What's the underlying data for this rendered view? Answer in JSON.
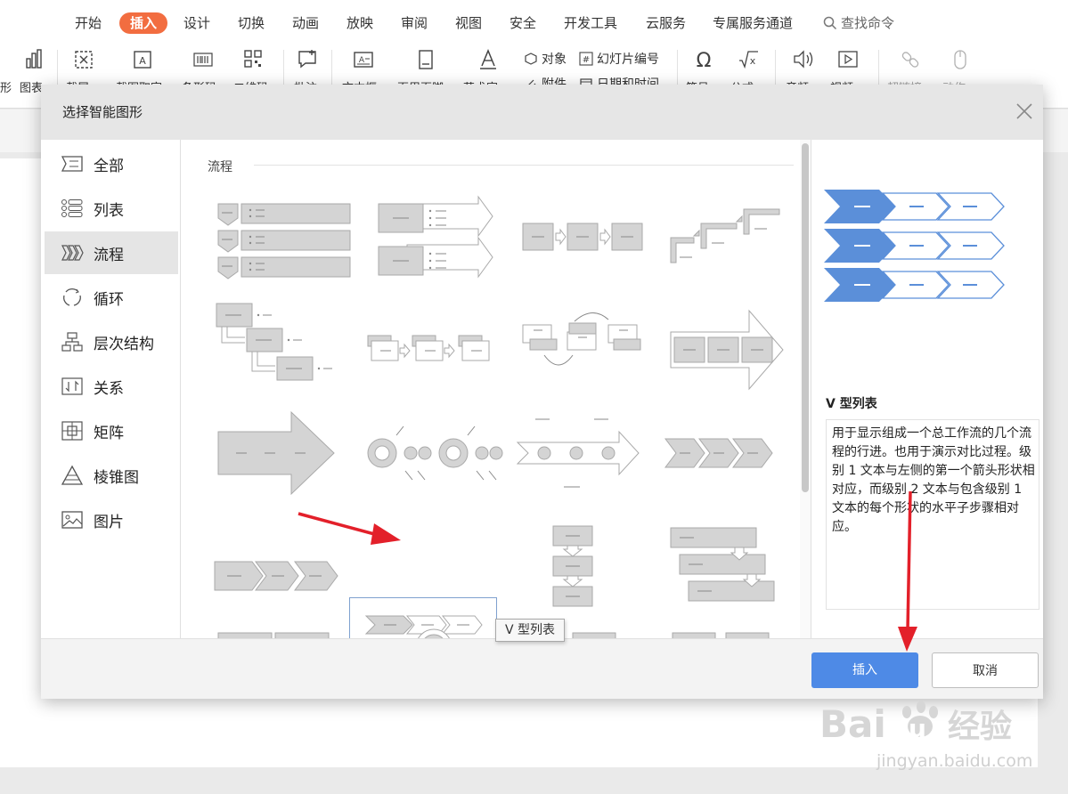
{
  "ribbon": {
    "tabs": [
      {
        "label": "开始",
        "active": false
      },
      {
        "label": "插入",
        "active": true
      },
      {
        "label": "设计",
        "active": false
      },
      {
        "label": "切换",
        "active": false
      },
      {
        "label": "动画",
        "active": false
      },
      {
        "label": "放映",
        "active": false
      },
      {
        "label": "审阅",
        "active": false
      },
      {
        "label": "视图",
        "active": false
      },
      {
        "label": "安全",
        "active": false
      },
      {
        "label": "开发工具",
        "active": false
      },
      {
        "label": "云服务",
        "active": false
      },
      {
        "label": "专属服务通道",
        "active": false
      }
    ],
    "search_label": "查找命令",
    "tools": [
      {
        "label": "形",
        "icon": "shape-icon"
      },
      {
        "label": "图表",
        "icon": "chart-icon"
      },
      {
        "label": "截屏",
        "icon": "screenshot-icon"
      },
      {
        "label": "截图取字",
        "icon": "ocr-icon"
      },
      {
        "label": "条形码",
        "icon": "barcode-icon"
      },
      {
        "label": "二维码",
        "icon": "qrcode-icon"
      },
      {
        "label": "批注",
        "icon": "comment-icon"
      },
      {
        "label": "文本框",
        "icon": "textbox-icon"
      },
      {
        "label": "页眉页脚",
        "icon": "header-footer-icon"
      },
      {
        "label": "艺术字",
        "icon": "wordart-icon"
      },
      {
        "label": "符号",
        "icon": "symbol-icon"
      },
      {
        "label": "公式",
        "icon": "formula-icon"
      },
      {
        "label": "音频",
        "icon": "audio-icon"
      },
      {
        "label": "视频",
        "icon": "video-icon"
      },
      {
        "label": "超链接",
        "icon": "hyperlink-icon"
      },
      {
        "label": "动作",
        "icon": "action-icon"
      }
    ],
    "mini_tools": {
      "object": "对象",
      "slide_number": "幻灯片编号",
      "attachment": "附件",
      "date_time": "日期和时间"
    }
  },
  "dialog": {
    "title": "选择智能图形",
    "categories": [
      {
        "label": "全部",
        "icon": "all-icon",
        "active": false
      },
      {
        "label": "列表",
        "icon": "list-icon",
        "active": false
      },
      {
        "label": "流程",
        "icon": "process-icon",
        "active": true
      },
      {
        "label": "循环",
        "icon": "cycle-icon",
        "active": false
      },
      {
        "label": "层次结构",
        "icon": "hierarchy-icon",
        "active": false
      },
      {
        "label": "关系",
        "icon": "relationship-icon",
        "active": false
      },
      {
        "label": "矩阵",
        "icon": "matrix-icon",
        "active": false
      },
      {
        "label": "棱锥图",
        "icon": "pyramid-icon",
        "active": false
      },
      {
        "label": "图片",
        "icon": "picture-icon",
        "active": false
      }
    ],
    "section_title": "流程",
    "selected_layout": "V 型列表",
    "preview": {
      "name": "V 型列表",
      "description": "用于显示组成一个总工作流的几个流程的行进。也用于演示对比过程。级别 1 文本与左侧的第一个箭头形状相对应，而级别 2 文本与包含级别 1 文本的每个形状的水平子步骤相对应。"
    },
    "buttons": {
      "insert": "插入",
      "cancel": "取消"
    },
    "tooltip": "V 型列表"
  },
  "watermark": {
    "brand": "Baidu经验",
    "url": "jingyan.baidu.com"
  },
  "colors": {
    "accent": "#4e8ae6",
    "tab_active": "#f26d40",
    "annotation_arrow": "#e3202a",
    "thumb_fill": "#d4d4d4"
  }
}
